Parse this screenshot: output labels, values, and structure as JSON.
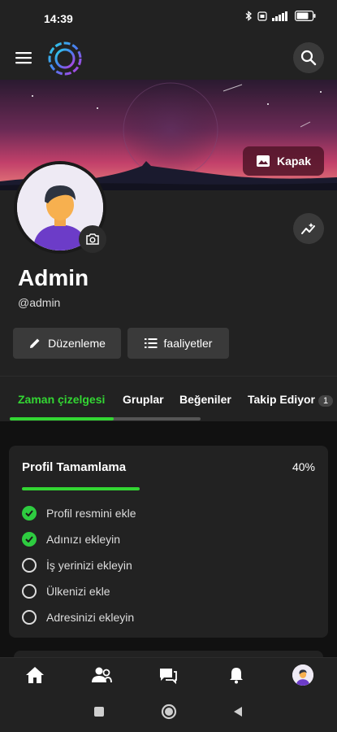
{
  "status_bar": {
    "time": "14:39",
    "battery": "76"
  },
  "header": {
    "menu_icon": "menu-icon",
    "logo": "app-logo",
    "search_icon": "search-icon"
  },
  "cover": {
    "button_label": "Kapak",
    "button_icon": "image-icon"
  },
  "profile": {
    "name": "Admin",
    "handle": "@admin",
    "edit_label": "Düzenleme",
    "activity_label": "faaliyetler"
  },
  "tabs": [
    {
      "label": "Zaman çizelgesi",
      "active": true
    },
    {
      "label": "Gruplar",
      "active": false
    },
    {
      "label": "Beğeniler",
      "active": false
    },
    {
      "label": "Takip Ediyor",
      "badge": "1",
      "active": false
    }
  ],
  "completion": {
    "title": "Profil Tamamlama",
    "percent_label": "40%",
    "percent": 40,
    "tasks": [
      {
        "label": "Profil resmini ekle",
        "done": true
      },
      {
        "label": "Adınızı ekleyin",
        "done": true
      },
      {
        "label": "İş yerinizi ekleyin",
        "done": false
      },
      {
        "label": "Ülkenizi ekle",
        "done": false
      },
      {
        "label": "Adresinizi ekleyin",
        "done": false
      }
    ]
  },
  "bottom_nav": [
    "home-icon",
    "friends-icon",
    "messages-icon",
    "notifications-icon",
    "profile-avatar"
  ],
  "colors": {
    "accent": "#33d633",
    "background": "#111111",
    "surface": "#222222",
    "button": "#3a3a3a"
  }
}
